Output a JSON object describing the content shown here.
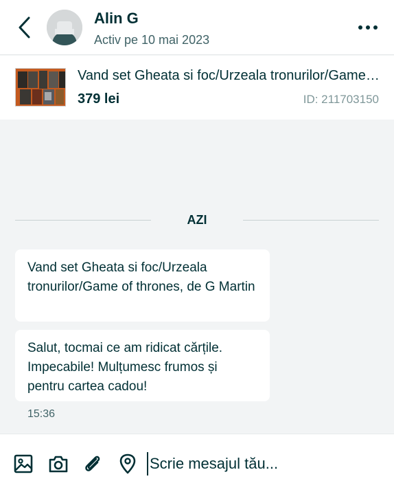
{
  "header": {
    "name": "Alin G",
    "status": "Activ pe 10 mai 2023",
    "back_icon": "chevron-left-icon",
    "more_icon": "more-horizontal-icon"
  },
  "listing": {
    "title": "Vand set Gheata si foc/Urzeala tronurilor/Game of thrones, de G Martin",
    "price": "379 lei",
    "id": "ID: 211703150"
  },
  "chat": {
    "day_label": "AZI",
    "messages": [
      {
        "text": "Vand set Gheata si foc/Urzeala tronurilor/Game of thrones, de G Martin"
      },
      {
        "text": "Salut, tocmai ce am ridicat cărțile. Impecabile! Mulțumesc frumos și pentru cartea cadou!",
        "time": "15:36"
      }
    ]
  },
  "composer": {
    "placeholder": "Scrie mesajul tău...",
    "icons": [
      "image-icon",
      "camera-icon",
      "paperclip-icon",
      "location-pin-icon"
    ]
  },
  "colors": {
    "primary_text": "#002f34",
    "muted_text": "#406367",
    "background": "#f2f4f5",
    "bubble": "#ffffff"
  }
}
